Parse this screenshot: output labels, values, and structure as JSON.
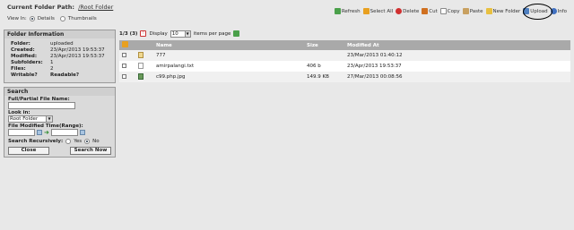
{
  "header": {
    "path_label": "Current Folder Path:",
    "path_link": "/Root Folder",
    "view_in_label": "View In:",
    "view_options": [
      {
        "label": "Details",
        "selected": true
      },
      {
        "label": "Thumbnails",
        "selected": false
      }
    ]
  },
  "toolbar": {
    "refresh": "Refresh",
    "select_all": "Select All",
    "delete": "Delete",
    "cut": "Cut",
    "copy": "Copy",
    "paste": "Paste",
    "new_folder": "New Folder",
    "upload": "Upload",
    "info": "Info"
  },
  "folder_info": {
    "title": "Folder Information",
    "rows": [
      {
        "label": "Folder:",
        "value": "uploaded"
      },
      {
        "label": "Created:",
        "value": "23/Apr/2013 19:53:37"
      },
      {
        "label": "Modified:",
        "value": "23/Apr/2013 19:53:37"
      },
      {
        "label": "Subfolders:",
        "value": "1"
      },
      {
        "label": "Files:",
        "value": "2"
      }
    ],
    "writable_label": "Writable?",
    "readable_label": "Readable?"
  },
  "search": {
    "title": "Search",
    "filename_label": "Full/Partial File Name:",
    "filename_value": "",
    "look_in_label": "Look in:",
    "look_in_value": "Root Folder",
    "modified_label": "File Modified Time(Range):",
    "recursive_label": "Search Recursively:",
    "recursive_options": [
      {
        "label": "Yes",
        "selected": false
      },
      {
        "label": "No",
        "selected": true
      }
    ],
    "close_label": "Close",
    "search_label": "Search Now"
  },
  "pager": {
    "position": "1/3 (3)",
    "display_label": "Display",
    "per_page_value": "10",
    "per_page_label": "items per page"
  },
  "table": {
    "columns": [
      "Name",
      "Size",
      "Modified At"
    ],
    "rows": [
      {
        "name": "777",
        "size": "",
        "modified": "23/Mar/2013 01:40:12",
        "type": "folder"
      },
      {
        "name": "amirpalangi.txt",
        "size": "406 b",
        "modified": "23/Apr/2013 19:53:37",
        "type": "text"
      },
      {
        "name": "c99.php.jpg",
        "size": "149.9 KB",
        "modified": "27/Mar/2013 00:08:56",
        "type": "image"
      }
    ]
  },
  "colors": {
    "background": "#e8e8e8",
    "table_header": "#a9a9a9",
    "annotation_circle": "#000000"
  }
}
